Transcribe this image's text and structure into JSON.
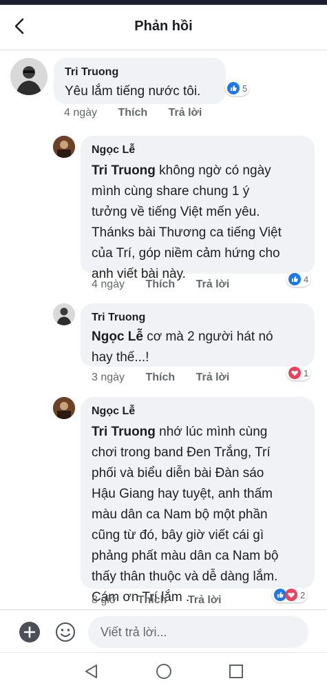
{
  "header": {
    "title": "Phản hồi"
  },
  "comments": [
    {
      "author": "Tri Truong",
      "text": "Yêu lắm tiếng nước tôi.",
      "time": "4 ngày",
      "like_label": "Thích",
      "reply_label": "Trả lời",
      "reactions": {
        "count": "5",
        "types": [
          "like"
        ]
      }
    },
    {
      "author": "Ngọc Lễ",
      "mention": "Tri Truong",
      "lines": [
        " không  ngờ có ngày",
        "mình cùng share chung 1 ý",
        "tưởng về tiếng Việt mến yêu.",
        "Thánks bài Thương ca tiếng Việt",
        "của Trí, góp niềm cảm hứng cho",
        "anh viết bài này."
      ],
      "time": "4 ngày",
      "like_label": "Thích",
      "reply_label": "Trả lời",
      "reactions": {
        "count": "4",
        "types": [
          "like"
        ]
      }
    },
    {
      "author": "Tri Truong",
      "mention": "Ngọc Lễ",
      "lines": [
        "  cơ mà 2 người hát nó",
        "hay thế...!"
      ],
      "time": "3 ngày",
      "like_label": "Thích",
      "reply_label": "Trả lời",
      "reactions": {
        "count": "1",
        "types": [
          "love"
        ]
      }
    },
    {
      "author": "Ngọc Lễ",
      "mention": "Tri Truong",
      "lines": [
        " nhớ lúc mình cùng",
        "chơi trong band Đen Trắng, Trí",
        "phối và biểu diễn bài Đàn sáo",
        "Hậu Giang hay tuyệt, anh thấm",
        "màu dân ca Nam bộ một phần",
        "cũng từ đó, bây giờ viết cái gì",
        "phảng phất màu dân ca Nam bộ",
        "thấy thân thuộc và dễ dàng lắm.",
        "Cám ơn Trí lắm ."
      ],
      "time": "8 giờ",
      "like_label": "Thích",
      "reply_label": "Trả lời",
      "reactions": {
        "count": "2",
        "types": [
          "like",
          "love"
        ]
      }
    }
  ],
  "composer": {
    "placeholder": "Viết trả lời..."
  },
  "colors": {
    "like": "#1877f2",
    "love": "#f33e58",
    "bubble": "#f0f2f5",
    "meta": "#65676b"
  }
}
